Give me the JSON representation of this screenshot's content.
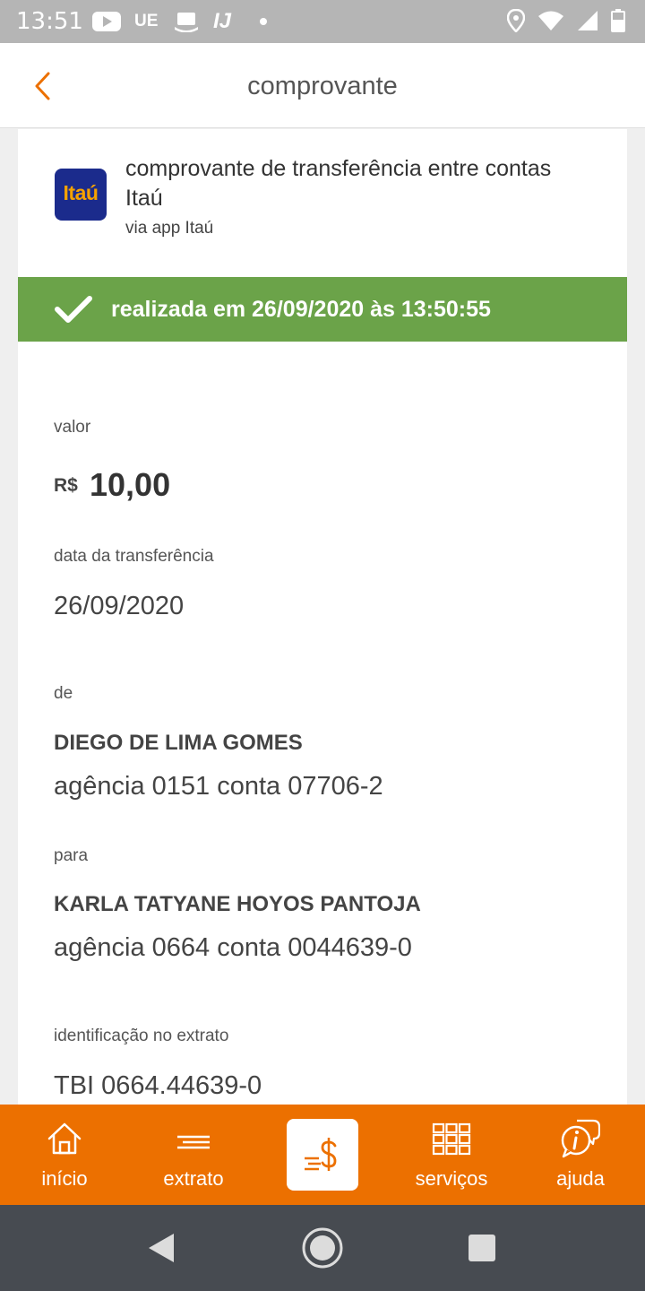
{
  "status_bar": {
    "time": "13:51",
    "ue_label": "UE",
    "ij_label": "IJ",
    "icons": [
      "youtube-icon",
      "ue-icon",
      "hat-icon",
      "ij-icon",
      "dot-icon",
      "location-icon",
      "wifi-icon",
      "signal-icon",
      "battery-icon"
    ]
  },
  "header": {
    "title": "comprovante",
    "back_icon": "chevron-left-icon",
    "accent_color": "#ec7000"
  },
  "receipt": {
    "logo_text": "Itaú",
    "title": "comprovante de transferência entre contas Itaú",
    "subtitle": "via app Itaú",
    "status_text": "realizada em 26/09/2020 às 13:50:55",
    "status_color": "#6ba349",
    "value_label": "valor",
    "currency": "R$",
    "amount": "10,00",
    "date_label": "data da transferência",
    "date": "26/09/2020",
    "from_label": "de",
    "from_name": "DIEGO DE LIMA GOMES",
    "from_account": "agência 0151 conta 07706-2",
    "to_label": "para",
    "to_name": "KARLA TATYANE HOYOS PANTOJA",
    "to_account": "agência 0664 conta 0044639-0",
    "statement_label": "identificação no extrato",
    "statement_id": "TBI 0664.44639-0"
  },
  "bottom_nav": {
    "items": [
      {
        "label": "início",
        "icon": "home-icon"
      },
      {
        "label": "extrato",
        "icon": "statement-icon"
      },
      {
        "label": "",
        "icon": "transfer-money-icon"
      },
      {
        "label": "serviços",
        "icon": "services-grid-icon"
      },
      {
        "label": "ajuda",
        "icon": "help-chat-icon"
      }
    ]
  },
  "system_nav": {
    "icons": [
      "back-triangle-icon",
      "home-circle-icon",
      "recents-square-icon"
    ]
  }
}
